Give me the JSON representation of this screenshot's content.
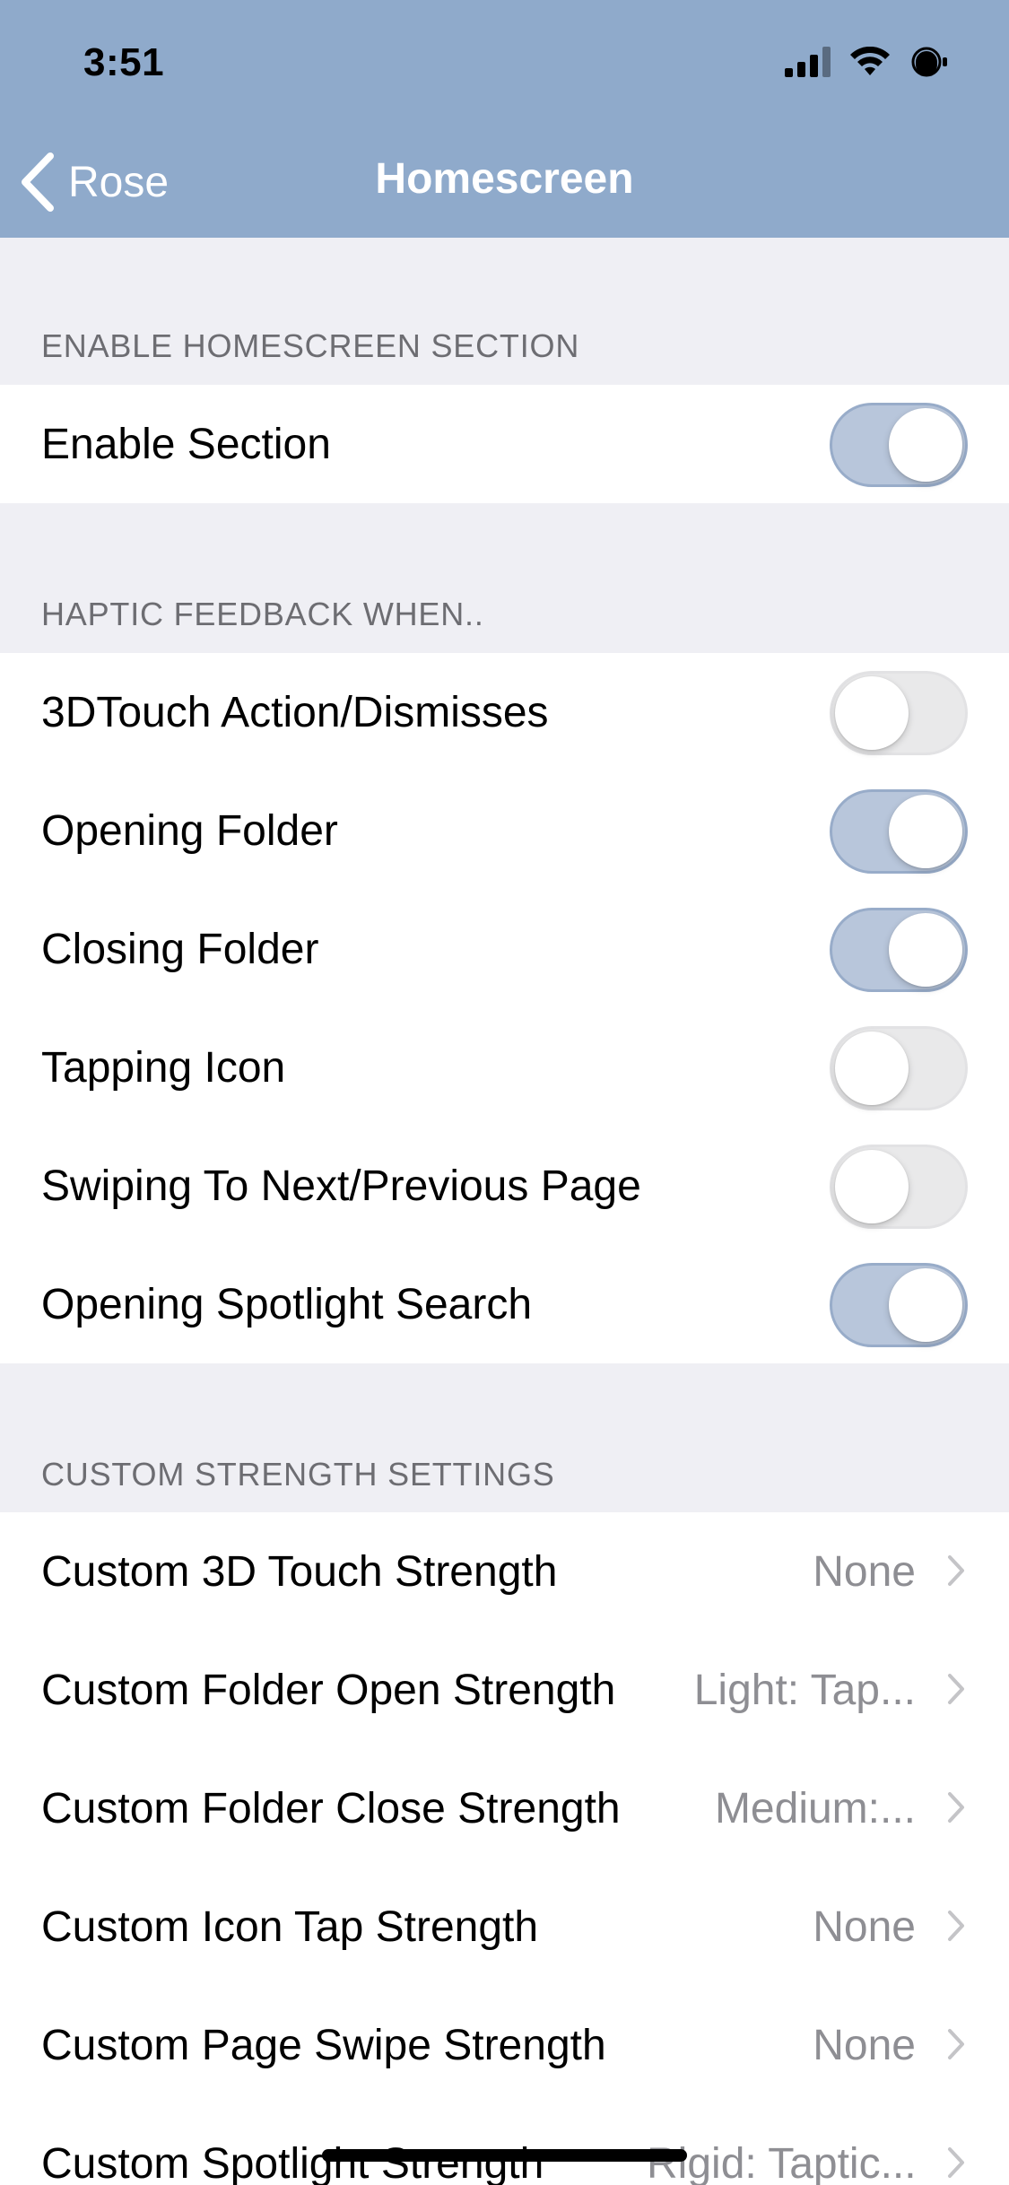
{
  "status_bar": {
    "time": "3:51",
    "icons": [
      "signal-icon",
      "wifi-icon",
      "battery-icon"
    ]
  },
  "nav": {
    "back_label": "Rose",
    "title": "Homescreen"
  },
  "sections": [
    {
      "header": "ENABLE HOMESCREEN SECTION",
      "rows": [
        {
          "label": "Enable Section",
          "toggle": true
        }
      ]
    },
    {
      "header": "HAPTIC FEEDBACK WHEN..",
      "rows": [
        {
          "label": "3DTouch Action/Dismisses",
          "toggle": false
        },
        {
          "label": "Opening Folder",
          "toggle": true
        },
        {
          "label": "Closing Folder",
          "toggle": true
        },
        {
          "label": "Tapping Icon",
          "toggle": false
        },
        {
          "label": "Swiping To Next/Previous Page",
          "toggle": false
        },
        {
          "label": "Opening Spotlight Search",
          "toggle": true
        }
      ]
    },
    {
      "header": "CUSTOM STRENGTH SETTINGS",
      "rows": [
        {
          "label": "Custom 3D Touch Strength",
          "value": "None"
        },
        {
          "label": "Custom Folder Open Strength",
          "value": "Light: Tap..."
        },
        {
          "label": "Custom Folder Close Strength",
          "value": "Medium:..."
        },
        {
          "label": "Custom Icon Tap Strength",
          "value": "None"
        },
        {
          "label": "Custom Page Swipe Strength",
          "value": "None"
        },
        {
          "label": "Custom Spotlight Strength",
          "value": "Rigid: Taptic..."
        }
      ]
    }
  ],
  "colors": {
    "nav_background": "#8faacb",
    "toggle_on": "#b8c6db",
    "toggle_off": "#e9e9ea",
    "background": "#efeff4"
  }
}
